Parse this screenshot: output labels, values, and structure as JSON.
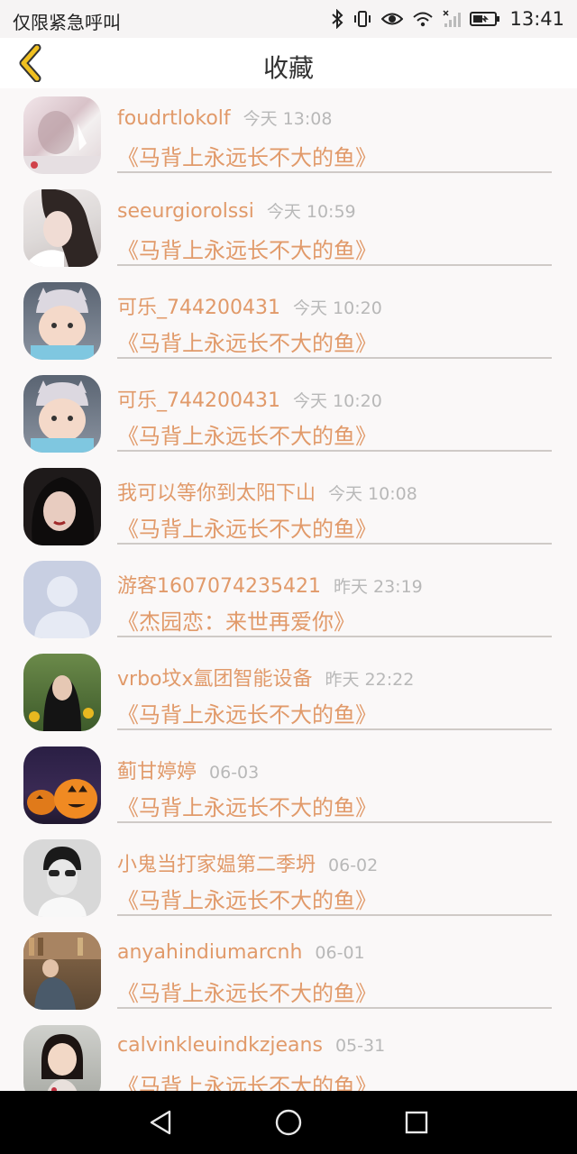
{
  "status_bar": {
    "left_text": "仅限紧急呼叫",
    "time": "13:41",
    "icons": [
      "bluetooth-icon",
      "vibrate-icon",
      "eye-icon",
      "wifi-icon",
      "signal-icon",
      "battery-icon"
    ]
  },
  "header": {
    "title": "收藏",
    "back_icon": "chevron-left-icon",
    "accent_color": "#f0c020"
  },
  "favorites": [
    {
      "user": "foudrtlokolf",
      "time": "今天 13:08",
      "book": "《马背上永远长不大的鱼》"
    },
    {
      "user": "seeurgiorolssi",
      "time": "今天 10:59",
      "book": "《马背上永远长不大的鱼》"
    },
    {
      "user": "可乐_744200431",
      "time": "今天 10:20",
      "book": "《马背上永远长不大的鱼》"
    },
    {
      "user": "可乐_744200431",
      "time": "今天 10:20",
      "book": "《马背上永远长不大的鱼》"
    },
    {
      "user": "我可以等你到太阳下山",
      "time": "今天 10:08",
      "book": "《马背上永远长不大的鱼》"
    },
    {
      "user": "游客1607074235421",
      "time": "昨天 23:19",
      "book": "《杰园恋：来世再爱你》"
    },
    {
      "user": "vrbo坟x氲团智能设备",
      "time": "昨天 22:22",
      "book": "《马背上永远长不大的鱼》"
    },
    {
      "user": "蓟甘婷婷",
      "time": "06-03",
      "book": "《马背上永远长不大的鱼》"
    },
    {
      "user": "小鬼当打家媪第二季坍",
      "time": "06-02",
      "book": "《马背上永远长不大的鱼》"
    },
    {
      "user": "anyahindiumarcnh",
      "time": "06-01",
      "book": "《马背上永远长不大的鱼》"
    },
    {
      "user": "calvinkleuindkzjeans",
      "time": "05-31",
      "book": "《马背上永远长不大的鱼》"
    }
  ],
  "colors": {
    "name_text": "#e19a6a",
    "time_text": "#b8b8b8",
    "divider": "#cfcac7"
  },
  "nav_bar": {
    "icons": [
      "back-triangle-icon",
      "home-circle-icon",
      "recents-square-icon"
    ]
  }
}
